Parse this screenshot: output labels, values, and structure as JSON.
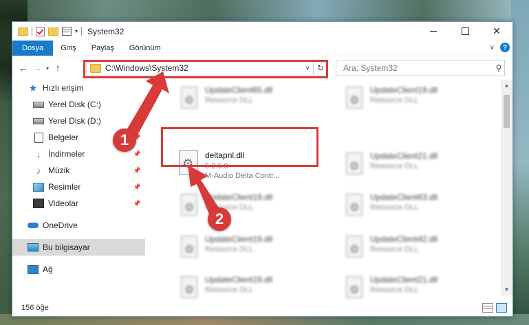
{
  "window": {
    "title": "System32",
    "controls": {
      "minimize": "–",
      "maximize": "□",
      "close": "✕"
    }
  },
  "ribbon": {
    "tabs": [
      "Dosya",
      "Giriş",
      "Paylaş",
      "Görünüm"
    ],
    "help": "?"
  },
  "address": {
    "path": "C:\\Windows\\System32",
    "search_placeholder": "Ara: System32"
  },
  "sidebar": {
    "items": [
      {
        "label": "Hızlı erişim",
        "icon": "star-icon"
      },
      {
        "label": "Yerel Disk (C:)",
        "icon": "disk-icon"
      },
      {
        "label": "Yerel Disk (D:)",
        "icon": "disk-icon"
      },
      {
        "label": "Belgeler",
        "icon": "document-icon"
      },
      {
        "label": "İndirmeler",
        "icon": "download-icon"
      },
      {
        "label": "Müzik",
        "icon": "music-icon"
      },
      {
        "label": "Resimler",
        "icon": "pictures-icon"
      },
      {
        "label": "Videolar",
        "icon": "video-icon"
      },
      {
        "label": "OneDrive",
        "icon": "cloud-icon"
      },
      {
        "label": "Bu bilgisayar",
        "icon": "pc-icon"
      },
      {
        "label": "Ağ",
        "icon": "network-icon"
      }
    ]
  },
  "files": {
    "selected": {
      "name": "deltapnl.dll",
      "version": "5.2.6.0",
      "description": "M-Audio Delta Contr..."
    },
    "blurred": [
      {
        "name": "UpdateClient65.dll",
        "type": "Resource DLL"
      },
      {
        "name": "UpdateClient19.dll",
        "type": "Resource DLL"
      },
      {
        "name": "UpdateClient21.dll",
        "type": "Resource DLL"
      },
      {
        "name": "UpdateClient19.dll",
        "type": "Resource DLL"
      },
      {
        "name": "UpdateClient63.dll",
        "type": "Resource DLL"
      },
      {
        "name": "UpdateClient19.dll",
        "type": "Resource DLL"
      },
      {
        "name": "UpdateClient42.dll",
        "type": "Resource DLL"
      },
      {
        "name": "UpdateClient19.dll",
        "type": "Resource DLL"
      },
      {
        "name": "UpdateClient21.dll",
        "type": "Resource DLL"
      }
    ]
  },
  "status": {
    "item_count": "156 öğe"
  },
  "callouts": {
    "one": "1",
    "two": "2"
  },
  "colors": {
    "accent": "#1979ca",
    "highlight": "#d83a3a"
  }
}
